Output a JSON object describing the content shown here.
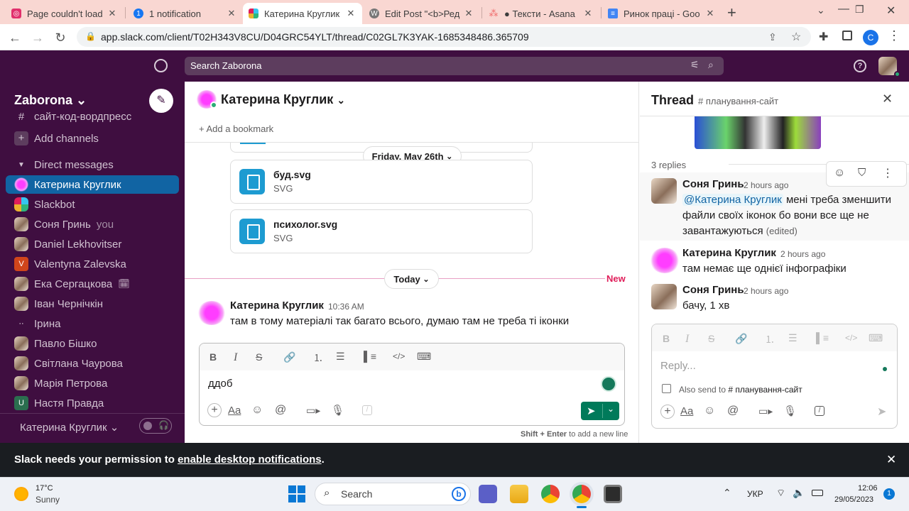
{
  "browser": {
    "tabs": [
      {
        "title": "Page couldn't load",
        "icon": "instagram-icon",
        "color": "#e1306c"
      },
      {
        "title": "1 notification",
        "icon": "notification-icon",
        "color": "#1877f2"
      },
      {
        "title": "Катерина Круглик",
        "icon": "slack-icon",
        "color": "#4a154b"
      },
      {
        "title": "Edit Post \"<b>Ред",
        "icon": "wordpress-icon",
        "color": "#555"
      },
      {
        "title": "● Тексти - Asana",
        "icon": "asana-icon",
        "color": "#f06a6a"
      },
      {
        "title": "Ринок праці - Goo",
        "icon": "docs-icon",
        "color": "#4285f4"
      }
    ],
    "url": "app.slack.com/client/T02H343V8CU/D04GRC54YLT/thread/C02GL7K3YAK-1685348486.365709",
    "profile_letter": "C"
  },
  "slack": {
    "search_placeholder": "Search Zaborona",
    "workspace": "Zaborona",
    "sidebar": {
      "channel_partial": "сайт-код-вордпресс",
      "add_channels": "Add channels",
      "dm_header": "Direct messages",
      "dms": [
        {
          "name": "Катерина Круглик",
          "avatar": "blob",
          "active": true
        },
        {
          "name": "Slackbot",
          "avatar": "slackbot"
        },
        {
          "name": "Соня Гринь",
          "suffix": "you",
          "avatar": "photo"
        },
        {
          "name": "Daniel Lekhovitser",
          "avatar": "photo"
        },
        {
          "name": "Valentyna Zalevska",
          "avatar": "letter",
          "letter": "V",
          "color": "#d0451b"
        },
        {
          "name": "Ека Сергацкова",
          "avatar": "photo",
          "emoji": "🗓"
        },
        {
          "name": "Іван Чернічкін",
          "avatar": "photo"
        },
        {
          "name": "Ірина",
          "avatar": "none"
        },
        {
          "name": "Павло Бішко",
          "avatar": "photo"
        },
        {
          "name": "Світлана Чаурова",
          "avatar": "photo"
        },
        {
          "name": "Марія Петрова",
          "avatar": "photo"
        },
        {
          "name": "Настя Правда",
          "avatar": "letter",
          "letter": "U",
          "color": "#2b6e4f"
        }
      ],
      "footer_user": "Катерина Круглик"
    },
    "conversation": {
      "title": "Катерина Круглик",
      "add_bookmark": "Add a bookmark",
      "date_divider": "Friday, May 26th",
      "files": [
        {
          "name": "буд.svg",
          "type": "SVG"
        },
        {
          "name": "психолог.svg",
          "type": "SVG"
        }
      ],
      "today_divider": "Today",
      "new_label": "New",
      "message": {
        "author": "Катерина Круглик",
        "time": "10:36 AM",
        "text": "там в тому матеріалі так багато всього, думаю там не треба ті іконки"
      },
      "composer_text": "ддоб",
      "composer_hint_bold": "Shift + Enter",
      "composer_hint": "to add a new line"
    },
    "thread": {
      "title": "Thread",
      "channel": "планування-сайт",
      "replies_count": "3 replies",
      "replies": [
        {
          "author": "Соня Гринь",
          "time": "2 hours ago",
          "mention": "@Катерина Круглик",
          "text": " мені треба зменшити файли своїх іконок бо вони все ще не завантажуються",
          "edited": "(edited)",
          "avatar": "photo"
        },
        {
          "author": "Катерина Круглик",
          "time": "2 hours ago",
          "text": "там немає ще однієї інфографіки",
          "avatar": "blob"
        },
        {
          "author": "Соня Гринь",
          "time": "2 hours ago",
          "text": "бачу, 1 хв",
          "avatar": "photo"
        }
      ],
      "reply_placeholder": "Reply...",
      "also_send_label": "Also send to",
      "also_send_channel": "планування-сайт"
    },
    "banner": {
      "prefix": "Slack needs your permission to ",
      "link": "enable desktop notifications",
      "suffix": "."
    }
  },
  "taskbar": {
    "weather_temp": "17°C",
    "weather_desc": "Sunny",
    "search_label": "Search",
    "language": "УКР",
    "time": "12:06",
    "date": "29/05/2023",
    "notification_count": "1"
  }
}
